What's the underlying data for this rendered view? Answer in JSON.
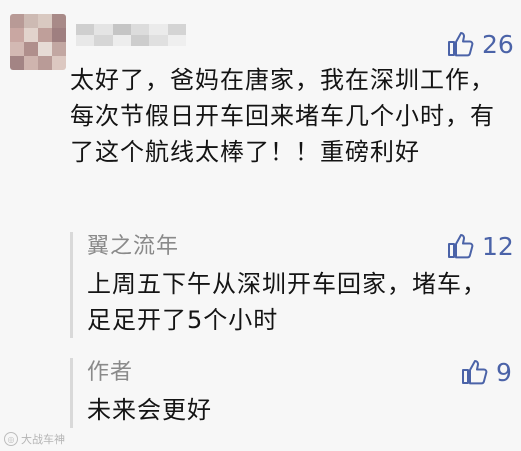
{
  "main_comment": {
    "like_count": "26",
    "text": "太好了，爸妈在唐家，我在深圳工作，每次节假日开车回来堵车几个小时，有了这个航线太棒了！！重磅利好"
  },
  "replies": [
    {
      "author": "翼之流年",
      "like_count": "12",
      "text": "上周五下午从深圳开车回家，堵车，足足开了5个小时"
    },
    {
      "author": "作者",
      "like_count": "9",
      "text": "未来会更好"
    }
  ],
  "watermark": {
    "text": "大战车神"
  },
  "colors": {
    "like_accent": "#4b63a8",
    "author_gray": "#8a8a8a",
    "background": "#f7f7f7"
  },
  "icons": {
    "like": "thumbs-up-icon"
  }
}
